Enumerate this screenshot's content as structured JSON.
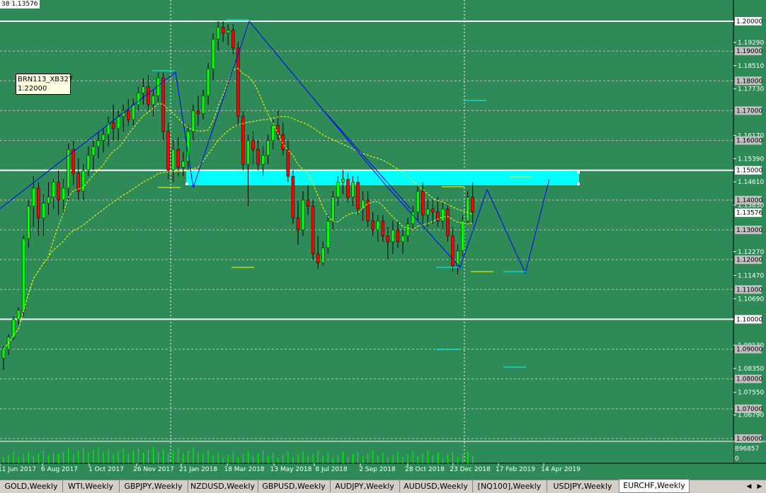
{
  "header": {
    "symbol_text": "38 1.13576"
  },
  "tooltip": {
    "name": "BRN113_XB327",
    "value": "1.22000"
  },
  "price_axis": {
    "plain": [
      "1.19290",
      "1.18510",
      "1.17730",
      "1.16170",
      "1.15390",
      "1.14610",
      "1.13830",
      "1.12270",
      "1.11470",
      "1.10690",
      "1.09130",
      "1.08350",
      "1.07550",
      "1.06790"
    ],
    "boxed": [
      "1.20000",
      "1.19000",
      "1.18000",
      "1.17000",
      "1.16000",
      "1.15000",
      "1.14000",
      "1.13000",
      "1.12000",
      "1.11000",
      "1.10000",
      "1.09000",
      "1.08000",
      "1.07000",
      "1.06000"
    ],
    "current": "1.13576"
  },
  "volume_axis": {
    "max": "896857",
    "min": "0"
  },
  "time_axis": [
    "11 Jun 2017",
    "6 Aug 2017",
    "1 Oct 2017",
    "26 Nov 2017",
    "21 Jan 2018",
    "18 Mar 2018",
    "13 May 2018",
    "8 Jul 2018",
    "2 Sep 2018",
    "28 Oct 2018",
    "23 Dec 2018",
    "17 Feb 2019",
    "14 Apr 2019"
  ],
  "tabs": [
    "GOLD,Weekly",
    "WTI,Weekly",
    "GBPJPY,Weekly",
    "NZDUSD,Weekly",
    "GBPUSD,Weekly",
    "AUDJPY,Weekly",
    "AUDUSD,Weekly",
    "[NQ100],Weekly",
    "USDJPY,Weekly",
    "EURCHF,Weekly"
  ],
  "active_tab": "EURCHF,Weekly",
  "colors": {
    "background": "#2e8b57",
    "bull": "#00ff00",
    "bear": "#ff0000",
    "zone": "#00ffff",
    "trendline": "#0000ff",
    "ma": "#ffff00"
  },
  "icons": {
    "scroll_left": "triangle-left-icon",
    "scroll_right": "triangle-right-icon"
  }
}
